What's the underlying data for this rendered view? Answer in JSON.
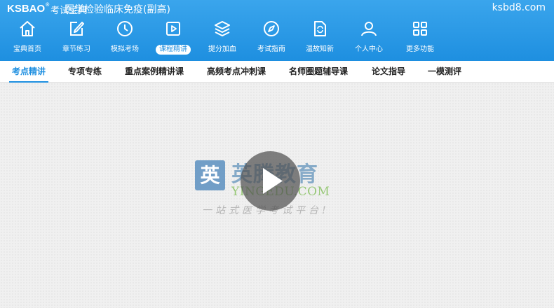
{
  "header": {
    "logo": "KSBAO",
    "logo_mark": "®",
    "logo_sub": "考试宝典",
    "title": "医学检验临床免疫(副高)",
    "site": "ksbd8.com"
  },
  "nav": [
    {
      "label": "宝典首页",
      "icon": "home-icon"
    },
    {
      "label": "章节练习",
      "icon": "edit-icon"
    },
    {
      "label": "模拟考场",
      "icon": "clock-icon"
    },
    {
      "label": "课程精讲",
      "icon": "play-icon",
      "active": true
    },
    {
      "label": "提分加血",
      "icon": "layers-icon"
    },
    {
      "label": "考试指南",
      "icon": "compass-icon"
    },
    {
      "label": "温故知新",
      "icon": "refresh-doc-icon"
    },
    {
      "label": "个人中心",
      "icon": "user-icon"
    },
    {
      "label": "更多功能",
      "icon": "grid-icon"
    }
  ],
  "subtabs": [
    {
      "label": "考点精讲",
      "active": true
    },
    {
      "label": "专项专练"
    },
    {
      "label": "重点案例精讲课"
    },
    {
      "label": "高频考点冲刺课"
    },
    {
      "label": "名师圈题辅导课"
    },
    {
      "label": "论文指导"
    },
    {
      "label": "一模测评"
    }
  ],
  "video": {
    "watermark_cn": "英腾教育",
    "watermark_en": "YINGEDU.COM",
    "watermark_slogan": "一站式医学考试平台!",
    "watermark_logo_char": "英",
    "play_icon": "play-circle-icon"
  },
  "colors": {
    "header_blue": "#1e8fe0",
    "active_tab": "#1e8fe0"
  }
}
